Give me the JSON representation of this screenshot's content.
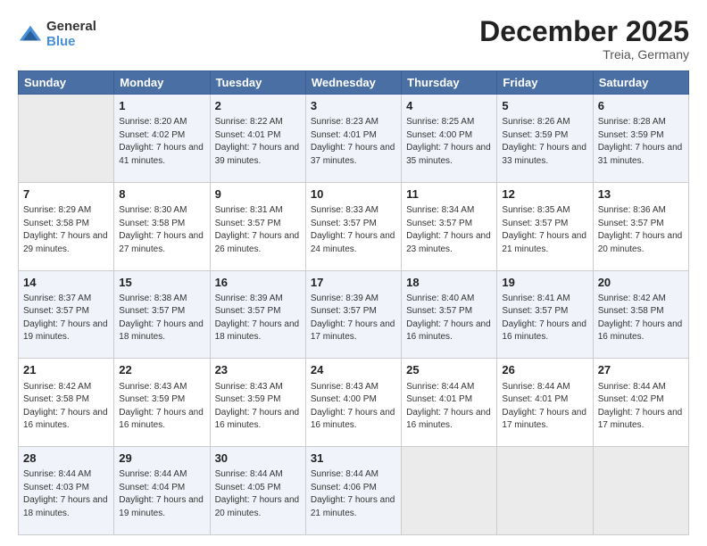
{
  "logo": {
    "general": "General",
    "blue": "Blue"
  },
  "title": "December 2025",
  "subtitle": "Treia, Germany",
  "days_header": [
    "Sunday",
    "Monday",
    "Tuesday",
    "Wednesday",
    "Thursday",
    "Friday",
    "Saturday"
  ],
  "weeks": [
    [
      {
        "num": "",
        "empty": true
      },
      {
        "num": "1",
        "sunrise": "Sunrise: 8:20 AM",
        "sunset": "Sunset: 4:02 PM",
        "daylight": "Daylight: 7 hours and 41 minutes."
      },
      {
        "num": "2",
        "sunrise": "Sunrise: 8:22 AM",
        "sunset": "Sunset: 4:01 PM",
        "daylight": "Daylight: 7 hours and 39 minutes."
      },
      {
        "num": "3",
        "sunrise": "Sunrise: 8:23 AM",
        "sunset": "Sunset: 4:01 PM",
        "daylight": "Daylight: 7 hours and 37 minutes."
      },
      {
        "num": "4",
        "sunrise": "Sunrise: 8:25 AM",
        "sunset": "Sunset: 4:00 PM",
        "daylight": "Daylight: 7 hours and 35 minutes."
      },
      {
        "num": "5",
        "sunrise": "Sunrise: 8:26 AM",
        "sunset": "Sunset: 3:59 PM",
        "daylight": "Daylight: 7 hours and 33 minutes."
      },
      {
        "num": "6",
        "sunrise": "Sunrise: 8:28 AM",
        "sunset": "Sunset: 3:59 PM",
        "daylight": "Daylight: 7 hours and 31 minutes."
      }
    ],
    [
      {
        "num": "7",
        "sunrise": "Sunrise: 8:29 AM",
        "sunset": "Sunset: 3:58 PM",
        "daylight": "Daylight: 7 hours and 29 minutes."
      },
      {
        "num": "8",
        "sunrise": "Sunrise: 8:30 AM",
        "sunset": "Sunset: 3:58 PM",
        "daylight": "Daylight: 7 hours and 27 minutes."
      },
      {
        "num": "9",
        "sunrise": "Sunrise: 8:31 AM",
        "sunset": "Sunset: 3:57 PM",
        "daylight": "Daylight: 7 hours and 26 minutes."
      },
      {
        "num": "10",
        "sunrise": "Sunrise: 8:33 AM",
        "sunset": "Sunset: 3:57 PM",
        "daylight": "Daylight: 7 hours and 24 minutes."
      },
      {
        "num": "11",
        "sunrise": "Sunrise: 8:34 AM",
        "sunset": "Sunset: 3:57 PM",
        "daylight": "Daylight: 7 hours and 23 minutes."
      },
      {
        "num": "12",
        "sunrise": "Sunrise: 8:35 AM",
        "sunset": "Sunset: 3:57 PM",
        "daylight": "Daylight: 7 hours and 21 minutes."
      },
      {
        "num": "13",
        "sunrise": "Sunrise: 8:36 AM",
        "sunset": "Sunset: 3:57 PM",
        "daylight": "Daylight: 7 hours and 20 minutes."
      }
    ],
    [
      {
        "num": "14",
        "sunrise": "Sunrise: 8:37 AM",
        "sunset": "Sunset: 3:57 PM",
        "daylight": "Daylight: 7 hours and 19 minutes."
      },
      {
        "num": "15",
        "sunrise": "Sunrise: 8:38 AM",
        "sunset": "Sunset: 3:57 PM",
        "daylight": "Daylight: 7 hours and 18 minutes."
      },
      {
        "num": "16",
        "sunrise": "Sunrise: 8:39 AM",
        "sunset": "Sunset: 3:57 PM",
        "daylight": "Daylight: 7 hours and 18 minutes."
      },
      {
        "num": "17",
        "sunrise": "Sunrise: 8:39 AM",
        "sunset": "Sunset: 3:57 PM",
        "daylight": "Daylight: 7 hours and 17 minutes."
      },
      {
        "num": "18",
        "sunrise": "Sunrise: 8:40 AM",
        "sunset": "Sunset: 3:57 PM",
        "daylight": "Daylight: 7 hours and 16 minutes."
      },
      {
        "num": "19",
        "sunrise": "Sunrise: 8:41 AM",
        "sunset": "Sunset: 3:57 PM",
        "daylight": "Daylight: 7 hours and 16 minutes."
      },
      {
        "num": "20",
        "sunrise": "Sunrise: 8:42 AM",
        "sunset": "Sunset: 3:58 PM",
        "daylight": "Daylight: 7 hours and 16 minutes."
      }
    ],
    [
      {
        "num": "21",
        "sunrise": "Sunrise: 8:42 AM",
        "sunset": "Sunset: 3:58 PM",
        "daylight": "Daylight: 7 hours and 16 minutes."
      },
      {
        "num": "22",
        "sunrise": "Sunrise: 8:43 AM",
        "sunset": "Sunset: 3:59 PM",
        "daylight": "Daylight: 7 hours and 16 minutes."
      },
      {
        "num": "23",
        "sunrise": "Sunrise: 8:43 AM",
        "sunset": "Sunset: 3:59 PM",
        "daylight": "Daylight: 7 hours and 16 minutes."
      },
      {
        "num": "24",
        "sunrise": "Sunrise: 8:43 AM",
        "sunset": "Sunset: 4:00 PM",
        "daylight": "Daylight: 7 hours and 16 minutes."
      },
      {
        "num": "25",
        "sunrise": "Sunrise: 8:44 AM",
        "sunset": "Sunset: 4:01 PM",
        "daylight": "Daylight: 7 hours and 16 minutes."
      },
      {
        "num": "26",
        "sunrise": "Sunrise: 8:44 AM",
        "sunset": "Sunset: 4:01 PM",
        "daylight": "Daylight: 7 hours and 17 minutes."
      },
      {
        "num": "27",
        "sunrise": "Sunrise: 8:44 AM",
        "sunset": "Sunset: 4:02 PM",
        "daylight": "Daylight: 7 hours and 17 minutes."
      }
    ],
    [
      {
        "num": "28",
        "sunrise": "Sunrise: 8:44 AM",
        "sunset": "Sunset: 4:03 PM",
        "daylight": "Daylight: 7 hours and 18 minutes."
      },
      {
        "num": "29",
        "sunrise": "Sunrise: 8:44 AM",
        "sunset": "Sunset: 4:04 PM",
        "daylight": "Daylight: 7 hours and 19 minutes."
      },
      {
        "num": "30",
        "sunrise": "Sunrise: 8:44 AM",
        "sunset": "Sunset: 4:05 PM",
        "daylight": "Daylight: 7 hours and 20 minutes."
      },
      {
        "num": "31",
        "sunrise": "Sunrise: 8:44 AM",
        "sunset": "Sunset: 4:06 PM",
        "daylight": "Daylight: 7 hours and 21 minutes."
      },
      {
        "num": "",
        "empty": true
      },
      {
        "num": "",
        "empty": true
      },
      {
        "num": "",
        "empty": true
      }
    ]
  ]
}
